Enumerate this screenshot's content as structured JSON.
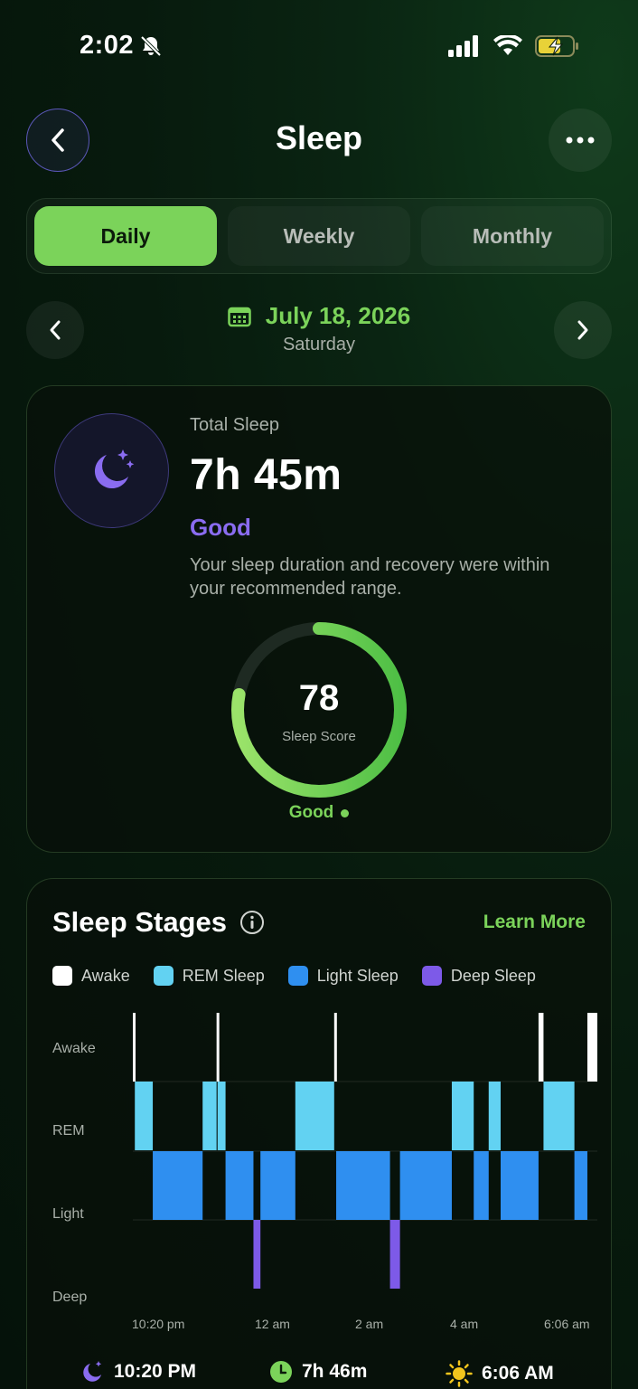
{
  "status_bar": {
    "time": "2:02"
  },
  "header": {
    "title": "Sleep"
  },
  "tabs": [
    {
      "label": "Daily",
      "active": true
    },
    {
      "label": "Weekly",
      "active": false
    },
    {
      "label": "Monthly",
      "active": false
    }
  ],
  "date": {
    "main": "July 18, 2026",
    "weekday": "Saturday"
  },
  "summary": {
    "total_label": "Total Sleep",
    "total_value": "7h 45m",
    "quality": "Good",
    "description": "Your sleep duration and recovery were within your recommended range.",
    "score": "78",
    "score_label": "Sleep Score",
    "score_status": "Good",
    "score_fraction": 0.78
  },
  "stages": {
    "title": "Sleep Stages",
    "learn_more": "Learn More",
    "legend": [
      "Awake",
      "REM Sleep",
      "Light Sleep",
      "Deep Sleep"
    ],
    "y_labels": [
      "Awake",
      "REM",
      "Light",
      "Deep"
    ],
    "x_labels": [
      "10:20 pm",
      "12 am",
      "2 am",
      "4 am",
      "6:06 am"
    ]
  },
  "colors": {
    "accent": "#7bd35a",
    "purple": "#8a6cf0",
    "awake": "#ffffff",
    "rem": "#62d2f2",
    "light": "#2f8ff0",
    "deep": "#7d5ae8"
  },
  "chart_data": {
    "type": "bar",
    "title": "Sleep Stages",
    "x_range": [
      "22:20",
      "06:06"
    ],
    "levels": [
      "Awake",
      "REM",
      "Light",
      "Deep"
    ],
    "segments": [
      {
        "stage": "Awake",
        "start": "22:20",
        "end": "22:22"
      },
      {
        "stage": "REM",
        "start": "22:22",
        "end": "22:40"
      },
      {
        "stage": "Light",
        "start": "22:40",
        "end": "23:30"
      },
      {
        "stage": "REM",
        "start": "23:30",
        "end": "23:44"
      },
      {
        "stage": "Awake",
        "start": "23:44",
        "end": "23:45"
      },
      {
        "stage": "REM",
        "start": "23:45",
        "end": "23:53"
      },
      {
        "stage": "Light",
        "start": "23:53",
        "end": "00:21"
      },
      {
        "stage": "Deep",
        "start": "00:21",
        "end": "00:28"
      },
      {
        "stage": "Light",
        "start": "00:28",
        "end": "01:03"
      },
      {
        "stage": "REM",
        "start": "01:03",
        "end": "01:42"
      },
      {
        "stage": "Awake",
        "start": "01:42",
        "end": "01:44"
      },
      {
        "stage": "Light",
        "start": "01:44",
        "end": "02:38"
      },
      {
        "stage": "Deep",
        "start": "02:38",
        "end": "02:48"
      },
      {
        "stage": "Light",
        "start": "02:48",
        "end": "03:40"
      },
      {
        "stage": "REM",
        "start": "03:40",
        "end": "04:02"
      },
      {
        "stage": "Light",
        "start": "04:02",
        "end": "04:17"
      },
      {
        "stage": "REM",
        "start": "04:17",
        "end": "04:29"
      },
      {
        "stage": "Light",
        "start": "04:29",
        "end": "05:07"
      },
      {
        "stage": "Awake",
        "start": "05:07",
        "end": "05:12"
      },
      {
        "stage": "REM",
        "start": "05:12",
        "end": "05:43"
      },
      {
        "stage": "Light",
        "start": "05:43",
        "end": "05:56"
      },
      {
        "stage": "Awake",
        "start": "05:56",
        "end": "06:06"
      }
    ]
  },
  "footer": {
    "bedtime": "10:20 PM",
    "duration": "7h 46m",
    "wake": "6:06 AM"
  }
}
